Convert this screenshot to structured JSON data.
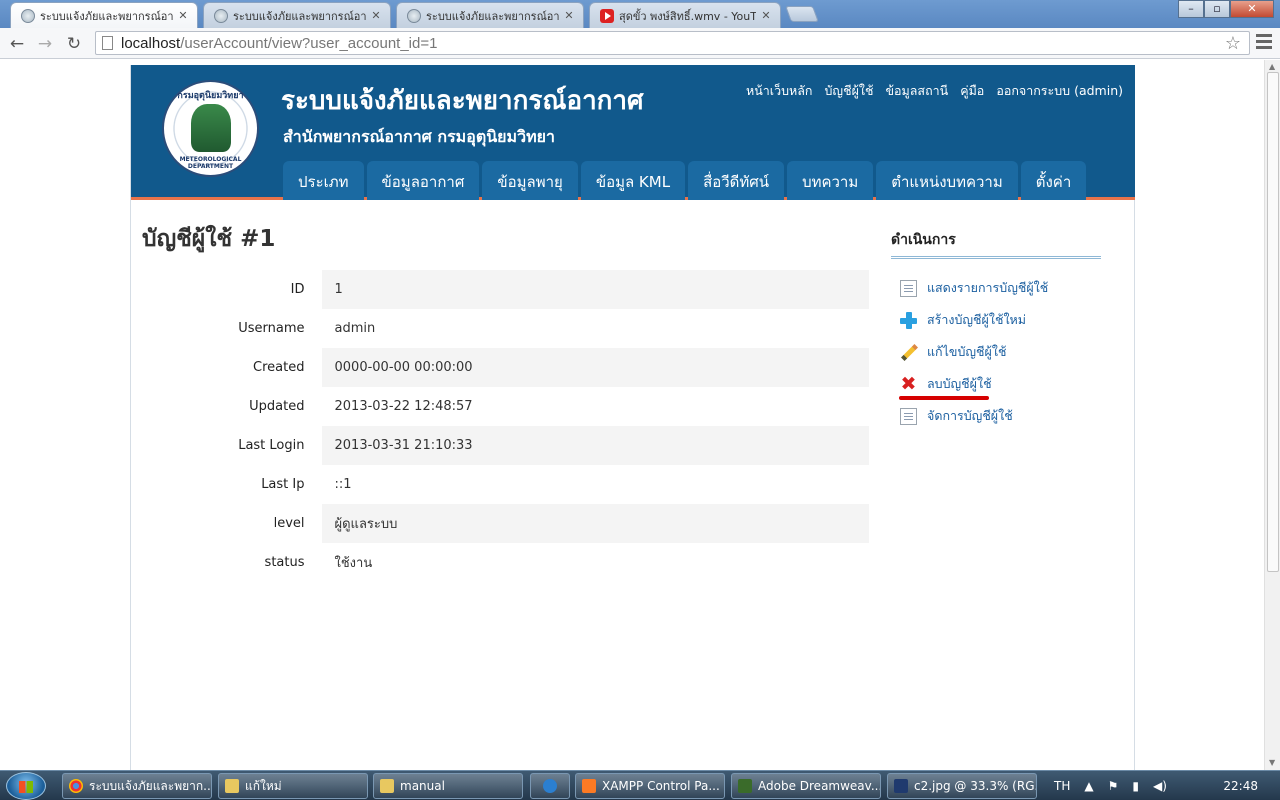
{
  "browser": {
    "tabs": [
      {
        "title": "ระบบแจ้งภัยและพยากรณ์อาก",
        "active": true,
        "icon": "site-emblem-icon"
      },
      {
        "title": "ระบบแจ้งภัยและพยากรณ์อาก",
        "active": false,
        "icon": "site-emblem-icon"
      },
      {
        "title": "ระบบแจ้งภัยและพยากรณ์อาก",
        "active": false,
        "icon": "site-emblem-icon"
      },
      {
        "title": "สุดขั้ว พงษ์สิทธิ์.wmv - YouT",
        "active": false,
        "icon": "youtube-icon"
      }
    ],
    "url_host": "localhost",
    "url_path": "/userAccount/view?user_account_id=1"
  },
  "header": {
    "title": "ระบบแจ้งภัยและพยากรณ์อากาศ",
    "subtitle": "สำนักพยากรณ์อากาศ กรมอุตุนิยมวิทยา",
    "logo_top_text": "กรมอุตุนิยมวิทยา",
    "logo_bottom_text": "METEOROLOGICAL DEPARTMENT",
    "top_links": [
      "หน้าเว็บหลัก",
      "บัญชีผู้ใช้",
      "ข้อมูลสถานี",
      "คู่มือ",
      "ออกจากระบบ (admin)"
    ],
    "main_nav": [
      "ประเภท",
      "ข้อมูลอากาศ",
      "ข้อมูลพายุ",
      "ข้อมูล KML",
      "สื่อวีดีทัศน์",
      "บทความ",
      "ตำแหน่งบทความ",
      "ตั้งค่า"
    ]
  },
  "main": {
    "page_title": "บัญชีผู้ใช้ #1",
    "details": [
      {
        "label": "ID",
        "value": "1"
      },
      {
        "label": "Username",
        "value": "admin"
      },
      {
        "label": "Created",
        "value": "0000-00-00 00:00:00"
      },
      {
        "label": "Updated",
        "value": "2013-03-22 12:48:57"
      },
      {
        "label": "Last Login",
        "value": "2013-03-31 21:10:33"
      },
      {
        "label": "Last Ip",
        "value": "::1"
      },
      {
        "label": "level",
        "value": "ผู้ดูแลระบบ"
      },
      {
        "label": "status",
        "value": "ใช้งาน"
      }
    ]
  },
  "sidebar": {
    "heading": "ดำเนินการ",
    "items": [
      {
        "label": "แสดงรายการบัญชีผู้ใช้",
        "icon": "list-document-icon"
      },
      {
        "label": "สร้างบัญชีผู้ใช้ใหม่",
        "icon": "plus-icon"
      },
      {
        "label": "แก้ไขบัญชีผู้ใช้",
        "icon": "pencil-icon"
      },
      {
        "label": "ลบบัญชีผู้ใช้",
        "icon": "delete-cross-icon"
      },
      {
        "label": "จัดการบัญชีผู้ใช้",
        "icon": "manage-document-icon"
      }
    ]
  },
  "taskbar": {
    "tasks": [
      {
        "label": "ระบบแจ้งภัยและพยาก...",
        "icon": "chrome-icon"
      },
      {
        "label": "แก้ใหม่",
        "icon": "folder-icon"
      },
      {
        "label": "manual",
        "icon": "folder-icon"
      },
      {
        "label": "",
        "icon": "internet-explorer-icon"
      },
      {
        "label": "XAMPP Control Pa...",
        "icon": "xampp-icon"
      },
      {
        "label": "Adobe Dreamweav...",
        "icon": "dreamweaver-icon"
      },
      {
        "label": "c2.jpg @ 33.3% (RG...",
        "icon": "photoshop-icon"
      }
    ],
    "language": "TH",
    "time": "22:48"
  },
  "colors": {
    "header_bg": "#11598c",
    "nav_tab_bg": "#1b6aa2",
    "header_accent": "#e8734a",
    "link": "#1b5fa0",
    "highlight_underline": "#d60000"
  }
}
